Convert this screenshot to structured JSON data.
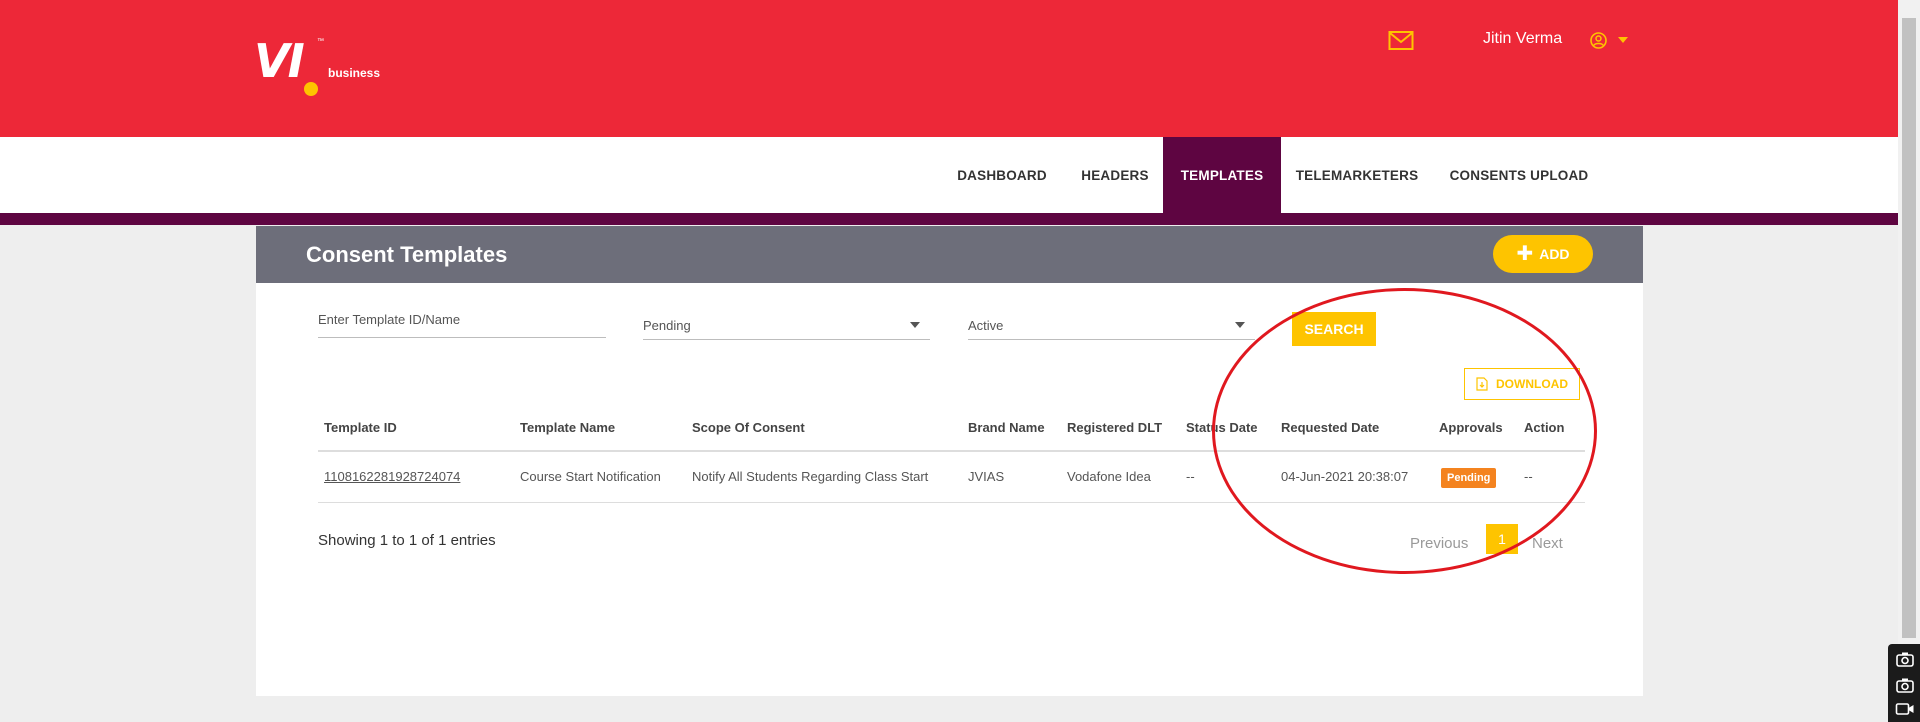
{
  "header": {
    "logo_text": "VI",
    "logo_tm": "™",
    "logo_sub": "business",
    "user_name": "Jitin Verma"
  },
  "nav": {
    "items": [
      {
        "label": "DASHBOARD"
      },
      {
        "label": "HEADERS"
      },
      {
        "label": "TEMPLATES"
      },
      {
        "label": "TELEMARKETERS"
      },
      {
        "label": "CONSENTS UPLOAD"
      }
    ],
    "active": "TEMPLATES"
  },
  "panel": {
    "title": "Consent Templates",
    "add_label": "ADD"
  },
  "filters": {
    "search_placeholder": "Enter Template ID/Name",
    "approval_value": "Pending",
    "status_value": "Active",
    "search_label": "SEARCH"
  },
  "download_label": "DOWNLOAD",
  "table": {
    "headers": [
      "Template ID",
      "Template Name",
      "Scope Of Consent",
      "Brand Name",
      "Registered DLT",
      "Status Date",
      "Requested Date",
      "Approvals",
      "Action"
    ],
    "rows": [
      [
        "1108162281928724074",
        "Course Start Notification",
        "Notify All Students Regarding Class Start",
        "JVIAS",
        "Vodafone Idea",
        "--",
        "04-Jun-2021 20:38:07",
        "Pending",
        "--"
      ]
    ]
  },
  "pagination": {
    "info": "Showing 1 to 1 of 1 entries",
    "previous": "Previous",
    "current": "1",
    "next": "Next"
  },
  "colors": {
    "brand_red": "#ed2838",
    "nav_active": "#5e0541",
    "accent_yellow": "#fec400",
    "panel_header": "#6d6e7a",
    "pending_badge": "#f4831f",
    "annotation": "#e0181f"
  },
  "icons": [
    "mail-icon",
    "user-circle-icon",
    "chevron-down-icon",
    "plus-icon",
    "file-download-icon",
    "camera-icon",
    "video-icon"
  ]
}
